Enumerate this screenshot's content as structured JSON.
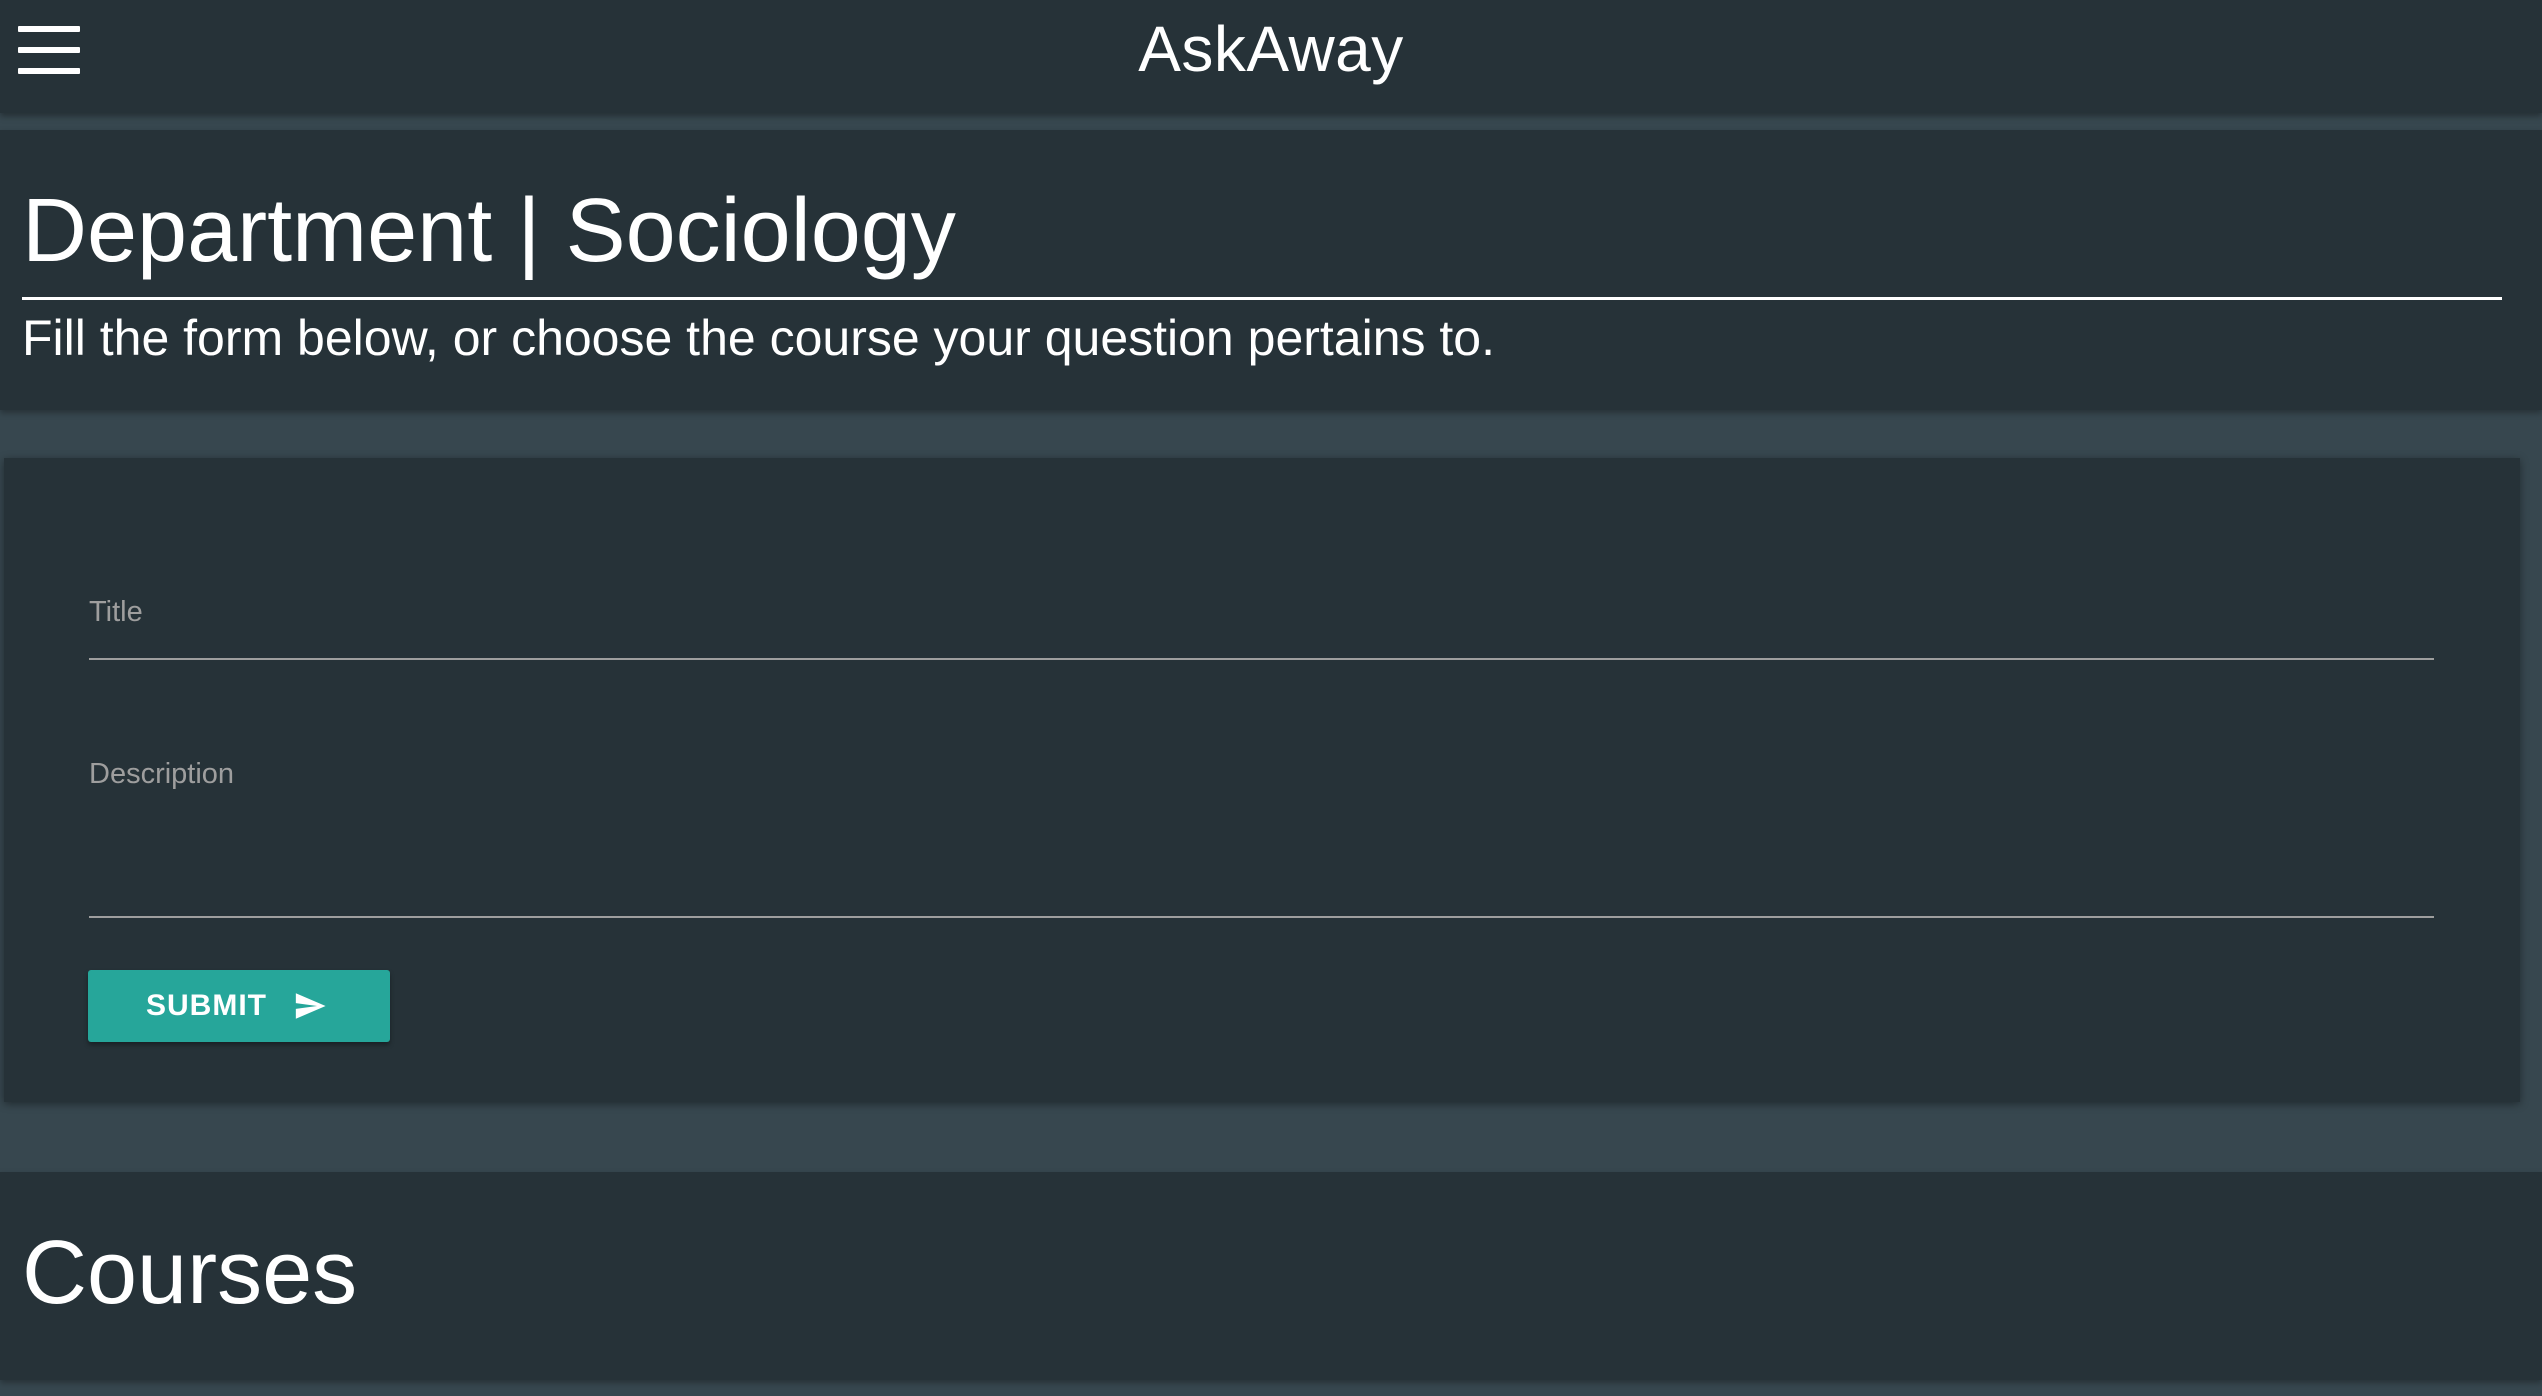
{
  "navbar": {
    "brand": "AskAway",
    "menu_icon": "hamburger-menu-icon"
  },
  "header": {
    "title": "Department | Sociology",
    "subtitle": "Fill the form below, or choose the course your question pertains to."
  },
  "form": {
    "title_label": "Title",
    "title_value": "",
    "description_label": "Description",
    "description_value": "",
    "submit_label": "SUBMIT",
    "submit_icon": "send-icon"
  },
  "courses": {
    "heading": "Courses"
  },
  "colors": {
    "background": "#37474f",
    "card": "#263238",
    "accent": "#26a69a",
    "label": "#9e9e9e"
  }
}
